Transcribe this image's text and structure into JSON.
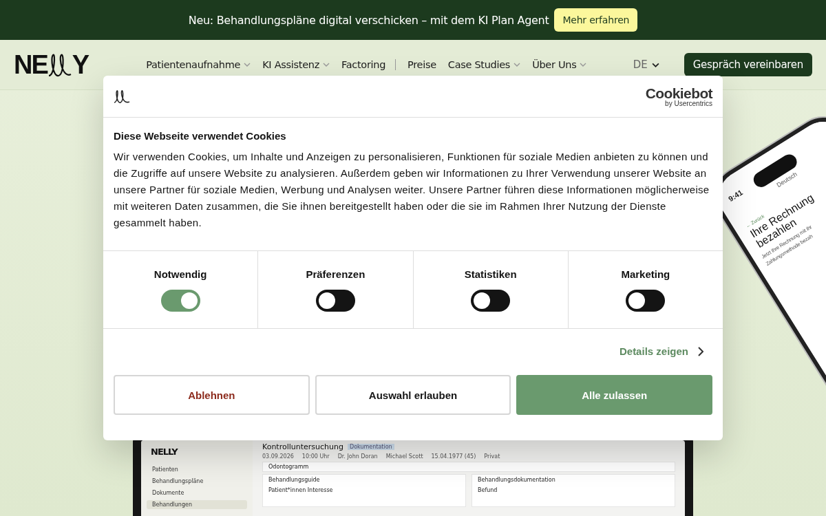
{
  "banner": {
    "text": "Neu: Behandlungspläne digital verschicken – mit dem KI Plan Agent",
    "button": "Mehr erfahren"
  },
  "nav": {
    "logo": {
      "left": "NE",
      "right": "Y"
    },
    "items": [
      {
        "label": "Patientenaufnahme",
        "dropdown": true,
        "divider_after": false
      },
      {
        "label": "KI Assistenz",
        "dropdown": true,
        "divider_after": false
      },
      {
        "label": "Factoring",
        "dropdown": false,
        "divider_after": true
      },
      {
        "label": "Preise",
        "dropdown": false,
        "divider_after": false
      },
      {
        "label": "Case Studies",
        "dropdown": true,
        "divider_after": false
      },
      {
        "label": "Über Uns",
        "dropdown": true,
        "divider_after": false
      }
    ],
    "language": "DE",
    "cta": "Gespräch vereinbaren"
  },
  "cookie_dialog": {
    "brand": "Cookiebot",
    "brand_sub": "by Usercentrics",
    "title": "Diese Webseite verwendet Cookies",
    "text": "Wir verwenden Cookies, um Inhalte und Anzeigen zu personalisieren, Funktionen für soziale Medien anbieten zu können und die Zugriffe auf unsere Website zu analysieren. Außerdem geben wir Informationen zu Ihrer Verwendung unserer Website an unsere Partner für soziale Medien, Werbung und Analysen weiter. Unsere Partner führen diese Informationen möglicherweise mit weiteren Daten zusammen, die Sie ihnen bereitgestellt haben oder die sie im Rahmen Ihrer Nutzung der Dienste gesammelt haben.",
    "categories": [
      {
        "label": "Notwendig",
        "on": true
      },
      {
        "label": "Präferenzen",
        "on": false
      },
      {
        "label": "Statistiken",
        "on": false
      },
      {
        "label": "Marketing",
        "on": false
      }
    ],
    "details_link": "Details zeigen",
    "buttons": [
      {
        "label": "Ablehnen",
        "kind": "reject"
      },
      {
        "label": "Auswahl erlauben",
        "kind": "outline"
      },
      {
        "label": "Alle zulassen",
        "kind": "primary"
      }
    ]
  },
  "laptop_app": {
    "logo": "NELLY",
    "sidebar": [
      {
        "label": "Patienten",
        "selected": false
      },
      {
        "label": "Behandlungspläne",
        "selected": false
      },
      {
        "label": "Dokumente",
        "selected": false
      },
      {
        "label": "Behandlungen",
        "selected": true
      }
    ],
    "title": "Kontrolluntersuchung",
    "badge": "Dokumentation",
    "meta": [
      "03.09.2026",
      "10:00 Uhr",
      "Dr. John Doran",
      "Michael Scott",
      "15.04.1977 (45)",
      "Privat"
    ],
    "panel": "Odontogramm",
    "left_card": "Behandlungsguide",
    "left_item": "Patient*innen Interesse",
    "right_card": "Behandlungsdokumentation",
    "right_item": "Befund"
  },
  "phone_app": {
    "time": "9:41",
    "language": "Deutsch",
    "back": "← Zurück",
    "title": "Ihre Rechnung bezahlen",
    "subtitle": "Jetzt Ihre Rechnung mit Ihr",
    "subtitle_2": "Zahlungsmethode bezah"
  }
}
